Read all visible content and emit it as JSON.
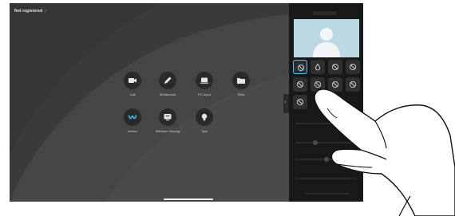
{
  "status": {
    "label": "Not registered",
    "chevron": "›"
  },
  "apps": [
    {
      "label": "Call",
      "icon": "camera-icon"
    },
    {
      "label": "Whiteboard",
      "icon": "pen-icon"
    },
    {
      "label": "PC Input",
      "icon": "laptop-icon"
    },
    {
      "label": "Files",
      "icon": "folder-icon"
    },
    {
      "label": "Webex",
      "icon": "webex-icon"
    },
    {
      "label": "Wireless Sharing",
      "icon": "share-screen-icon"
    },
    {
      "label": "Tips",
      "icon": "lightbulb-icon"
    }
  ],
  "panel": {
    "collapse_glyph": "‹",
    "effects": [
      {
        "icon": "none-icon",
        "selected": true
      },
      {
        "icon": "drop-icon",
        "selected": false
      },
      {
        "icon": "none-icon",
        "selected": false
      },
      {
        "icon": "none-icon",
        "selected": false
      },
      {
        "icon": "none-icon",
        "selected": false
      },
      {
        "icon": "none-icon",
        "selected": false
      },
      {
        "icon": "none-icon",
        "selected": false
      },
      {
        "icon": "none-icon",
        "selected": false
      },
      {
        "icon": "none-icon",
        "selected": false
      }
    ]
  },
  "colors": {
    "accent": "#5fb9e6",
    "screen_bg": "#3d3d3d",
    "panel_bg": "#181818",
    "preview_bg": "#bcd8e2"
  }
}
